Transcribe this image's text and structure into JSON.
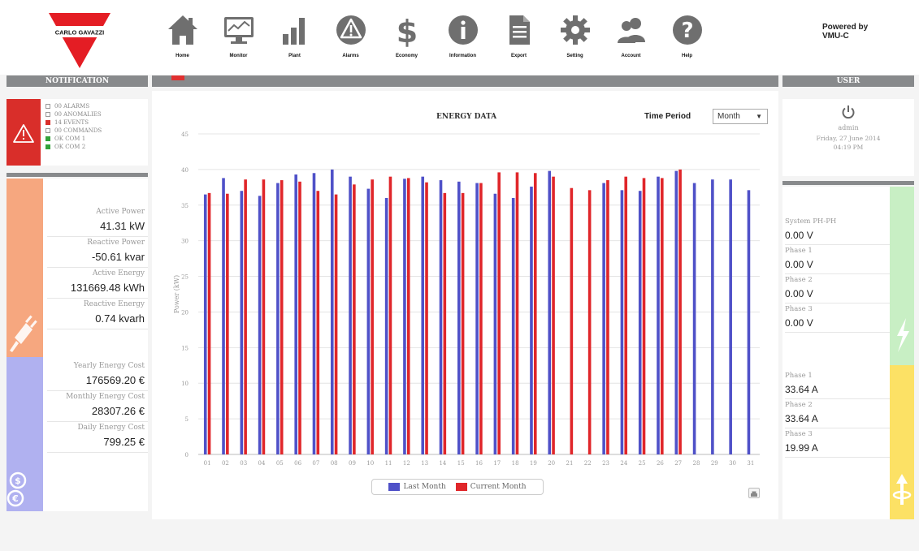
{
  "header": {
    "logo_text": "CARLO GAVAZZI",
    "powered_line1": "Powered by",
    "powered_line2": "VMU-C"
  },
  "nav": [
    {
      "label": "Home",
      "icon": "home-icon"
    },
    {
      "label": "Monitor",
      "icon": "monitor-icon"
    },
    {
      "label": "Plant",
      "icon": "bar-chart-icon"
    },
    {
      "label": "Alarms",
      "icon": "warning-icon"
    },
    {
      "label": "Economy",
      "icon": "dollar-icon"
    },
    {
      "label": "Information",
      "icon": "info-icon"
    },
    {
      "label": "Export",
      "icon": "document-icon"
    },
    {
      "label": "Setting",
      "icon": "gear-icon"
    },
    {
      "label": "Account",
      "icon": "users-icon"
    },
    {
      "label": "Help",
      "icon": "help-icon"
    }
  ],
  "notification": {
    "title": "NOTIFICATION",
    "rows": [
      {
        "status": "empty",
        "count": "00",
        "label": "ALARMS"
      },
      {
        "status": "empty",
        "count": "00",
        "label": "ANOMALIES"
      },
      {
        "status": "red",
        "count": "14",
        "label": "EVENTS"
      },
      {
        "status": "empty",
        "count": "00",
        "label": "COMMANDS"
      },
      {
        "status": "green",
        "count": "OK",
        "label": "COM 1"
      },
      {
        "status": "green",
        "count": "OK",
        "label": "COM 2"
      }
    ]
  },
  "energy": {
    "active_power_label": "Active Power",
    "active_power": "41.31 kW",
    "reactive_power_label": "Reactive Power",
    "reactive_power": "-50.61 kvar",
    "active_energy_label": "Active Energy",
    "active_energy": "131669.48 kWh",
    "reactive_energy_label": "Reactive Energy",
    "reactive_energy": "0.74 kvarh"
  },
  "cost": {
    "yearly_label": "Yearly Energy Cost",
    "yearly": "176569.20 €",
    "monthly_label": "Monthly Energy Cost",
    "monthly": "28307.26 €",
    "daily_label": "Daily Energy Cost",
    "daily": "799.25 €"
  },
  "chart_panel": {
    "period_label": "Time Period",
    "period_value": "Month"
  },
  "user": {
    "title": "USER",
    "name": "admin",
    "date": "Friday, 27 June 2014",
    "time": "04:19 PM"
  },
  "voltage": {
    "system_label": "System PH-PH",
    "system": "0.00 V",
    "p1_label": "Phase 1",
    "p1": "0.00 V",
    "p2_label": "Phase 2",
    "p2": "0.00 V",
    "p3_label": "Phase 3",
    "p3": "0.00 V"
  },
  "current": {
    "p1_label": "Phase 1",
    "p1": "33.64 A",
    "p2_label": "Phase 2",
    "p2": "33.64 A",
    "p3_label": "Phase 3",
    "p3": "19.99 A"
  },
  "colors": {
    "last_month": "#4f51c8",
    "current_month": "#e0262a",
    "alert": "#d92e2a",
    "energy_strip": "#f6a77f",
    "cost_strip": "#b0b1f0",
    "voltage_strip": "#c8efc4",
    "current_strip": "#fce165"
  },
  "chart_data": {
    "type": "bar",
    "title": "ENERGY DATA",
    "ylabel": "Power (kW)",
    "xlabel": "",
    "ylim": [
      0,
      45
    ],
    "yticks": [
      0,
      5,
      10,
      15,
      20,
      25,
      30,
      35,
      40,
      45
    ],
    "grid": true,
    "legend_position": "bottom",
    "categories": [
      "01",
      "02",
      "03",
      "04",
      "05",
      "06",
      "07",
      "08",
      "09",
      "10",
      "11",
      "12",
      "13",
      "14",
      "15",
      "16",
      "17",
      "18",
      "19",
      "20",
      "21",
      "22",
      "23",
      "24",
      "25",
      "26",
      "27",
      "28",
      "29",
      "30",
      "31"
    ],
    "series": [
      {
        "name": "Last Month",
        "values": [
          36.5,
          38.8,
          37.0,
          36.3,
          38.1,
          39.3,
          39.5,
          40.0,
          39.0,
          37.3,
          36.0,
          38.7,
          39.0,
          38.5,
          38.3,
          38.1,
          36.6,
          36.0,
          37.6,
          39.8,
          0,
          0,
          38.1,
          37.1,
          37.0,
          39.0,
          39.8,
          38.1,
          38.6,
          38.6,
          37.1
        ]
      },
      {
        "name": "Current Month",
        "values": [
          36.7,
          36.6,
          38.6,
          38.6,
          38.5,
          38.3,
          37.0,
          36.5,
          37.9,
          38.6,
          39.0,
          38.8,
          38.2,
          36.7,
          36.7,
          38.1,
          39.6,
          39.6,
          39.5,
          39.0,
          37.4,
          37.1,
          38.5,
          39.0,
          38.8,
          38.8,
          40.0,
          0,
          0,
          0,
          0
        ]
      }
    ]
  }
}
